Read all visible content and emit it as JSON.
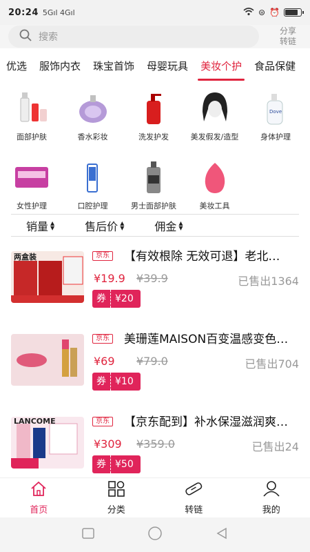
{
  "status": {
    "time": "20:24",
    "signal": "5Gıl 4Gıl",
    "battery_level": 0.8
  },
  "search": {
    "placeholder": "搜索"
  },
  "share": {
    "line1": "分享",
    "line2": "转链"
  },
  "tabs": [
    "优选",
    "服饰内衣",
    "珠宝首饰",
    "母婴玩具",
    "美妆个护",
    "食品保健"
  ],
  "active_tab": "美妆个护",
  "categories": [
    {
      "label": "面部护肤",
      "icon": "skincare-bottles-icon"
    },
    {
      "label": "香水彩妆",
      "icon": "perfume-icon"
    },
    {
      "label": "洗发护发",
      "icon": "shampoo-icon"
    },
    {
      "label": "美发假发/造型",
      "icon": "wig-icon"
    },
    {
      "label": "身体护理",
      "icon": "body-wash-icon"
    },
    {
      "label": "女性护理",
      "icon": "pads-icon"
    },
    {
      "label": "口腔护理",
      "icon": "toothpaste-icon"
    },
    {
      "label": "男士面部护肤",
      "icon": "men-skincare-icon"
    },
    {
      "label": "美妆工具",
      "icon": "beauty-sponge-icon"
    }
  ],
  "sort": [
    "销量",
    "售后价",
    "佣金"
  ],
  "products": [
    {
      "tag": "京东",
      "title": "【有效根除 无效可退】老北京脚气利器",
      "price": "¥19.9",
      "orig": "¥39.9",
      "sold": "已售出1364",
      "coupon_label": "券",
      "coupon": "¥20",
      "thumb_text": "两盒装"
    },
    {
      "tag": "京东",
      "title": "美珊莲MAISON百变温感变色口红",
      "price": "¥69",
      "orig": "¥79.0",
      "sold": "已售出704",
      "coupon_label": "券",
      "coupon": "¥10",
      "thumb_text": ""
    },
    {
      "tag": "京东",
      "title": "【京东配到】补水保湿滋润爽肤水",
      "price": "¥309",
      "orig": "¥359.0",
      "sold": "已售出24",
      "coupon_label": "券",
      "coupon": "¥50",
      "thumb_text": "LANCOME"
    }
  ],
  "tabbar": [
    {
      "label": "首页",
      "icon": "home-icon"
    },
    {
      "label": "分类",
      "icon": "category-grid-icon"
    },
    {
      "label": "转链",
      "icon": "link-icon"
    },
    {
      "label": "我的",
      "icon": "profile-icon"
    }
  ],
  "colors": {
    "accent": "#e0243e",
    "coupon": "#e0245a"
  }
}
